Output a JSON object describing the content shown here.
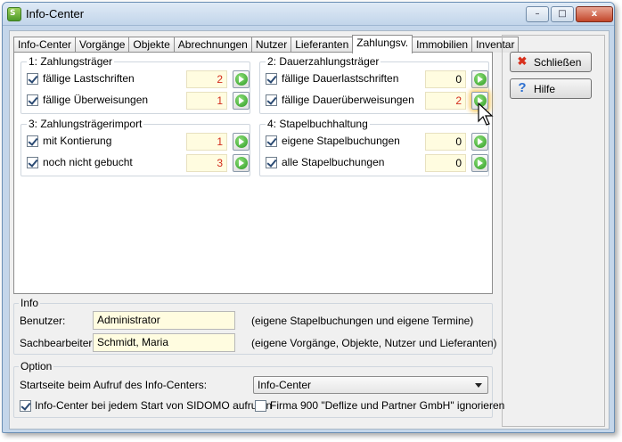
{
  "window": {
    "title": "Info-Center",
    "app_icon": "sidomo-app-icon",
    "min_label": "–",
    "max_label": "□",
    "close_label": "x"
  },
  "tabs": [
    {
      "label": "Info-Center"
    },
    {
      "label": "Vorgänge"
    },
    {
      "label": "Objekte"
    },
    {
      "label": "Abrechnungen"
    },
    {
      "label": "Nutzer"
    },
    {
      "label": "Lieferanten"
    },
    {
      "label": "Zahlungsv.",
      "active": true
    },
    {
      "label": "Immobilien"
    },
    {
      "label": "Inventar"
    }
  ],
  "groups": {
    "zahlungstraeger": {
      "title": "1: Zahlungsträger",
      "rows": [
        {
          "label": "fällige Lastschriften",
          "checked": true,
          "value": "2",
          "highlight": true
        },
        {
          "label": "fällige Überweisungen",
          "checked": true,
          "value": "1",
          "highlight": true
        }
      ]
    },
    "dauerzahlungstraeger": {
      "title": "2: Dauerzahlungsträger",
      "rows": [
        {
          "label": "fällige Dauerlastschriften",
          "checked": true,
          "value": "0",
          "highlight": false
        },
        {
          "label": "fällige Dauerüberweisungen",
          "checked": true,
          "value": "2",
          "highlight": true
        }
      ]
    },
    "zahlungstraegerimport": {
      "title": "3: Zahlungsträgerimport",
      "rows": [
        {
          "label": "mit Kontierung",
          "checked": true,
          "value": "1",
          "highlight": true
        },
        {
          "label": "noch nicht gebucht",
          "checked": true,
          "value": "3",
          "highlight": true
        }
      ]
    },
    "stapelbuchhaltung": {
      "title": "4: Stapelbuchhaltung",
      "rows": [
        {
          "label": "eigene Stapelbuchungen",
          "checked": true,
          "value": "0",
          "highlight": false
        },
        {
          "label": "alle Stapelbuchungen",
          "checked": true,
          "value": "0",
          "highlight": false
        }
      ]
    }
  },
  "side_buttons": {
    "close": {
      "label": "Schließen",
      "icon": "red-x-icon"
    },
    "help": {
      "label": "Hilfe",
      "icon": "question-mark-icon"
    }
  },
  "info": {
    "title": "Info",
    "benutzer_label": "Benutzer:",
    "benutzer_value": "Administrator",
    "benutzer_note": "(eigene Stapelbuchungen und eigene Termine)",
    "sachbearbeiter_label": "Sachbearbeiter:",
    "sachbearbeiter_value": "Schmidt, Maria",
    "sachbearbeiter_note": "(eigene Vorgänge, Objekte, Nutzer und Lieferanten)"
  },
  "option": {
    "title": "Option",
    "startseite_label": "Startseite beim Aufruf des Info-Centers:",
    "startseite_value": "Info-Center",
    "autostart_label": "Info-Center bei jedem Start von SIDOMO aufrufen",
    "autostart_checked": true,
    "ignore_label": "Firma 900 \"Deflize und Partner GmbH\" ignorieren",
    "ignore_checked": false
  },
  "colors": {
    "highlight_value": "#d32b1a",
    "count_field_bg": "#fffce0",
    "go_button_green": "#2a9a21"
  }
}
